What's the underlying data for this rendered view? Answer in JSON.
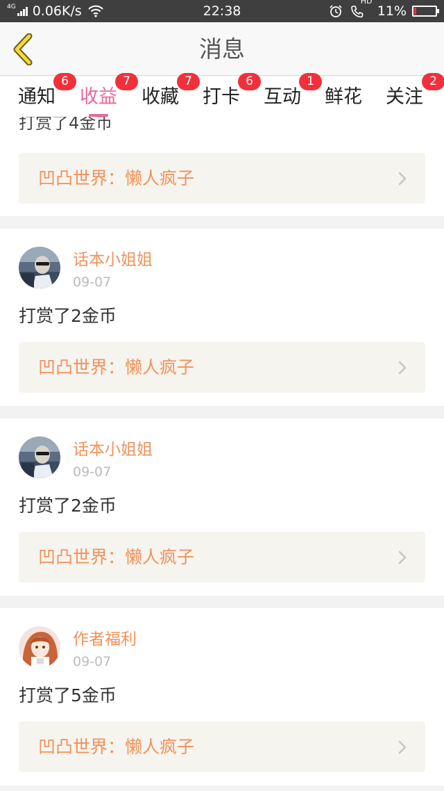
{
  "status_bar": {
    "network": "4G",
    "speed": "0.06K/s",
    "time": "22:38",
    "battery_text": "11%",
    "battery_level": 0.11,
    "icons": [
      "signal-icon",
      "wifi-icon",
      "alarm-icon",
      "call-hd-icon",
      "battery-icon"
    ],
    "hd_label": "HD"
  },
  "header": {
    "title": "消息",
    "back_icon": "chevron-left-icon"
  },
  "tabs": [
    {
      "label": "通知",
      "badge": "6"
    },
    {
      "label": "收益",
      "badge": "7",
      "active": true
    },
    {
      "label": "收藏",
      "badge": "7"
    },
    {
      "label": "打卡",
      "badge": "6"
    },
    {
      "label": "互动",
      "badge": "1"
    },
    {
      "label": "鲜花",
      "badge": ""
    },
    {
      "label": "关注",
      "badge": "2"
    }
  ],
  "messages": [
    {
      "partial": true,
      "text": "打赏了4金币",
      "reference": "凹凸世界：懒人疯子"
    },
    {
      "user": "话本小姐姐",
      "date": "09-07",
      "text": "打赏了2金币",
      "reference": "凹凸世界：懒人疯子",
      "avatar": "avatar-photo-man"
    },
    {
      "user": "话本小姐姐",
      "date": "09-07",
      "text": "打赏了2金币",
      "reference": "凹凸世界：懒人疯子",
      "avatar": "avatar-photo-man"
    },
    {
      "user": "作者福利",
      "date": "09-07",
      "text": "打赏了5金币",
      "reference": "凹凸世界：懒人疯子",
      "avatar": "avatar-anime-girl"
    }
  ],
  "colors": {
    "accent_pink": "#e8689b",
    "name_orange": "#f0925a",
    "badge_red": "#f2303b",
    "back_yellow": "#f4d93a",
    "ref_bg": "#f6f4ef"
  }
}
